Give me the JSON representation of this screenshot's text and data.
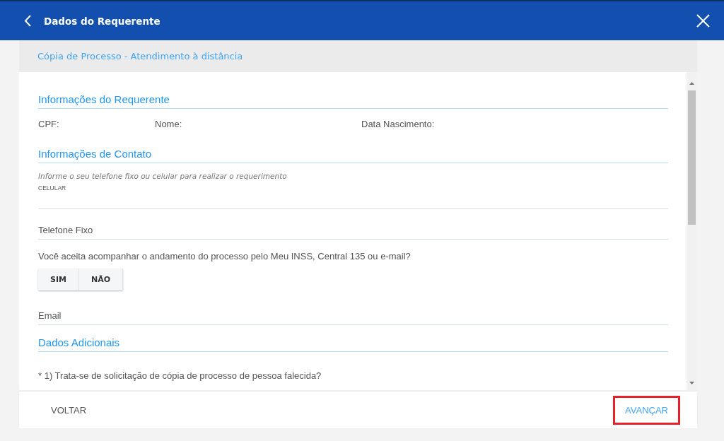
{
  "header": {
    "title": "Dados do Requerente"
  },
  "subtitle": "Cópia de Processo - Atendimento à distância",
  "sections": [
    {
      "kind": "heading",
      "text": "Informações do Requerente"
    },
    {
      "kind": "info",
      "fields": [
        "CPF:",
        "Nome:",
        "Data Nascimento:"
      ]
    },
    {
      "kind": "heading",
      "text": "Informações de Contato"
    },
    {
      "kind": "hint",
      "text": "Informe o seu telefone fixo ou celular para realizar o requerimento"
    },
    {
      "kind": "input",
      "label": "CELULAR",
      "small": true
    },
    {
      "kind": "input",
      "label": "Telefone Fixo",
      "small": false
    },
    {
      "kind": "question",
      "text": "Você aceita acompanhar o andamento do processo pelo Meu INSS, Central 135 ou e-mail?"
    },
    {
      "kind": "toggle",
      "options": [
        {
          "label": "SIM",
          "selected": false
        },
        {
          "label": "NÃO",
          "selected": false
        }
      ]
    },
    {
      "kind": "input",
      "label": "Email",
      "small": false
    },
    {
      "kind": "heading",
      "text": "Dados Adicionais"
    },
    {
      "kind": "question",
      "text": "* 1) Trata-se de solicitação de cópia de processo de pessoa falecida?"
    }
  ],
  "footer": {
    "buttons": [
      {
        "label": "VOLTAR",
        "kind": "secondary",
        "highlighted": false
      },
      {
        "label": "AVANÇAR",
        "kind": "primary",
        "highlighted": true
      }
    ]
  }
}
